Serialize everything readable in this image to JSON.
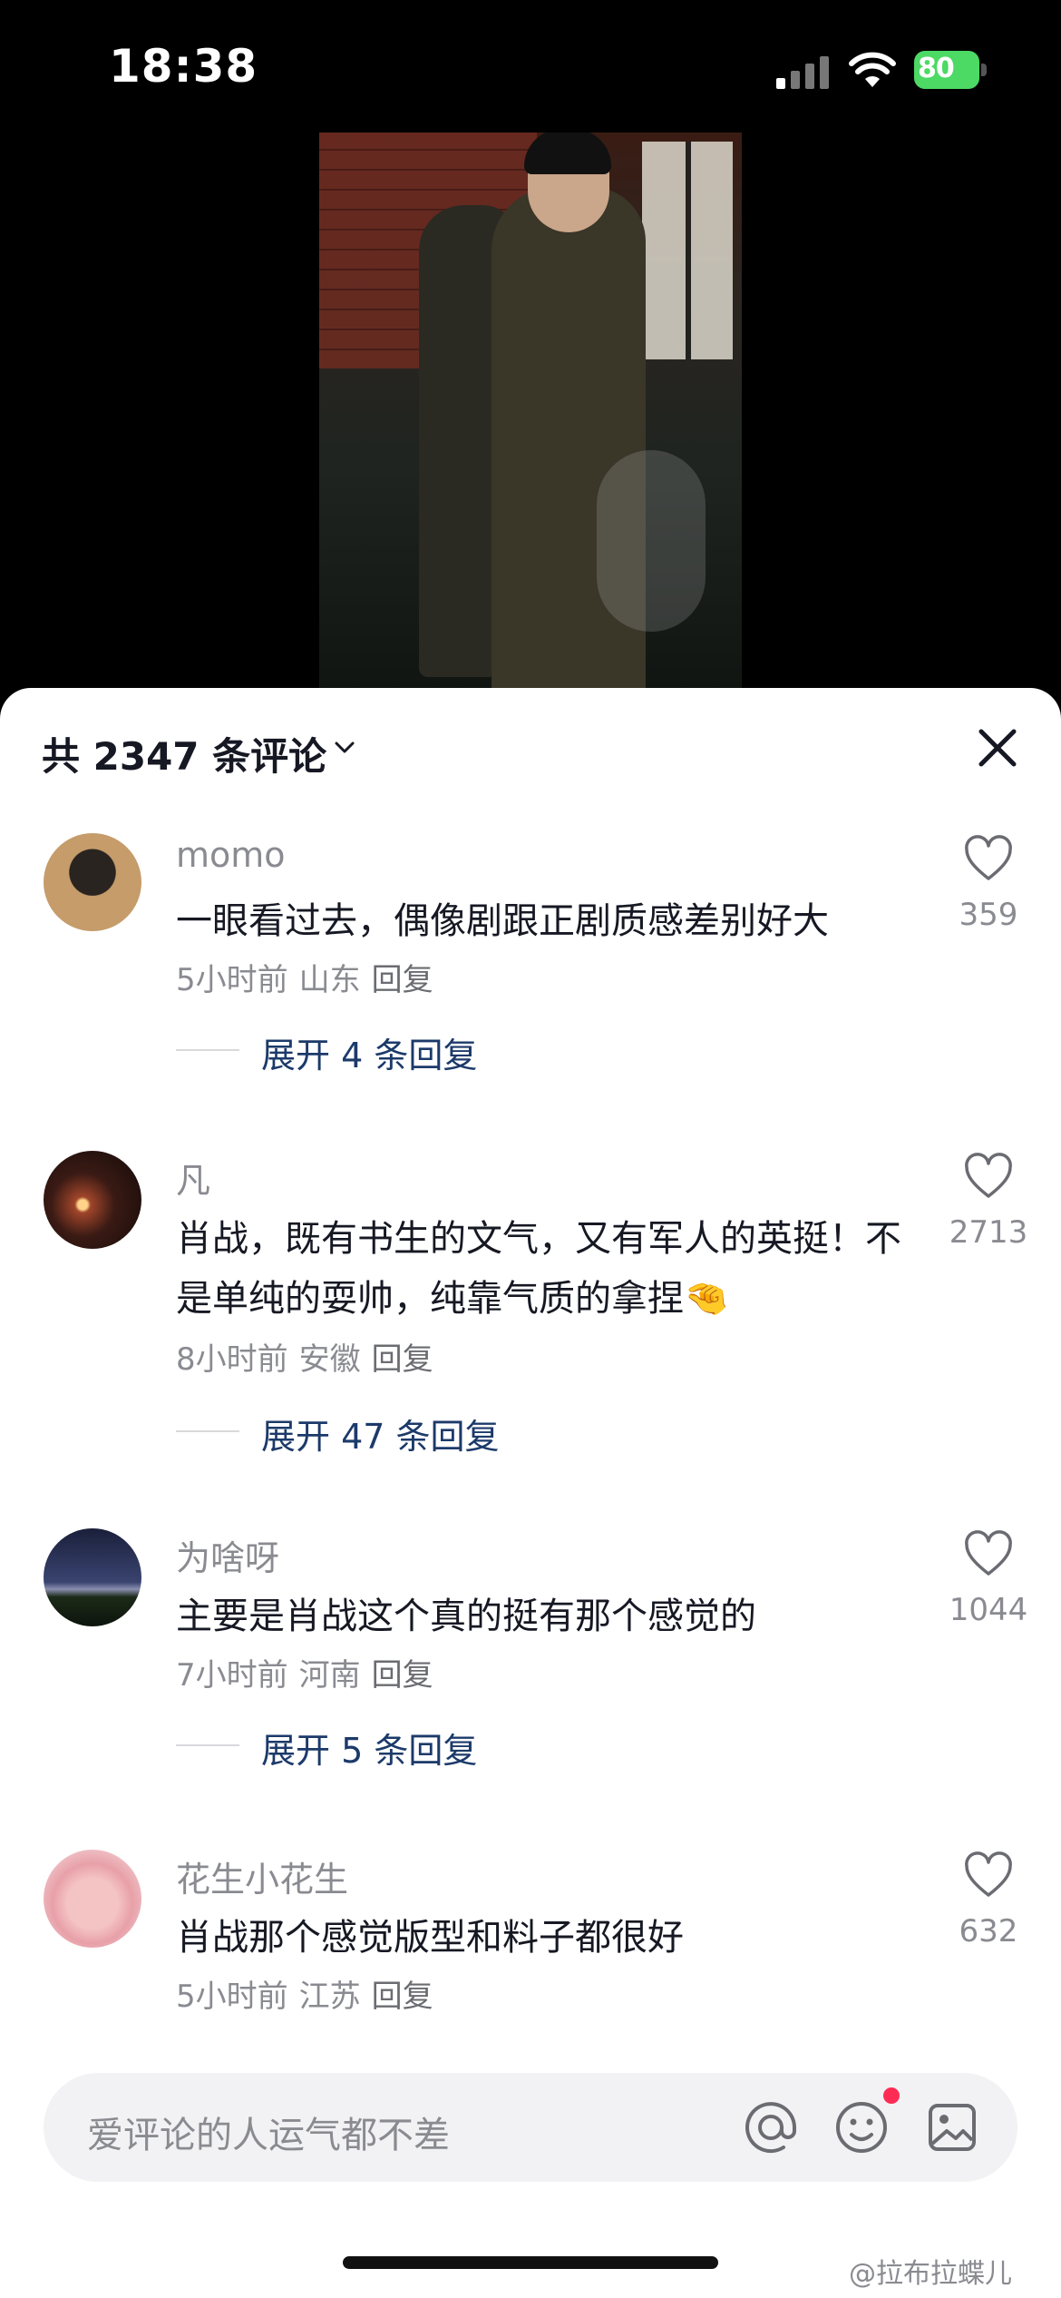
{
  "status_bar": {
    "time": "18:38",
    "battery": "80"
  },
  "header": {
    "comment_count_title": "共 2347 条评论"
  },
  "comments": [
    {
      "username": "momo",
      "text": "一眼看过去，偶像剧跟正剧质感差别好大",
      "time": "5小时前",
      "location": "山东",
      "reply_label": "回复",
      "likes": "359",
      "expand_label": "展开 4 条回复"
    },
    {
      "username": "凡",
      "text": "肖战，既有书生的文气，又有军人的英挺！不是单纯的耍帅，纯靠气质的拿捏🤏",
      "time": "8小时前",
      "location": "安徽",
      "reply_label": "回复",
      "likes": "2713",
      "expand_label": "展开 47 条回复"
    },
    {
      "username": "为啥呀",
      "text": "主要是肖战这个真的挺有那个感觉的",
      "time": "7小时前",
      "location": "河南",
      "reply_label": "回复",
      "likes": "1044",
      "expand_label": "展开 5 条回复"
    },
    {
      "username": "花生小花生",
      "text": "肖战那个感觉版型和料子都很好",
      "time": "5小时前",
      "location": "江苏",
      "reply_label": "回复",
      "likes": "632"
    }
  ],
  "input": {
    "placeholder": "爱评论的人运气都不差"
  },
  "watermark": "@拉布拉蝶儿",
  "colors": {
    "accent_red": "#fe2c55",
    "link_blue": "#1c3a6a",
    "battery_green": "#4cd964"
  }
}
